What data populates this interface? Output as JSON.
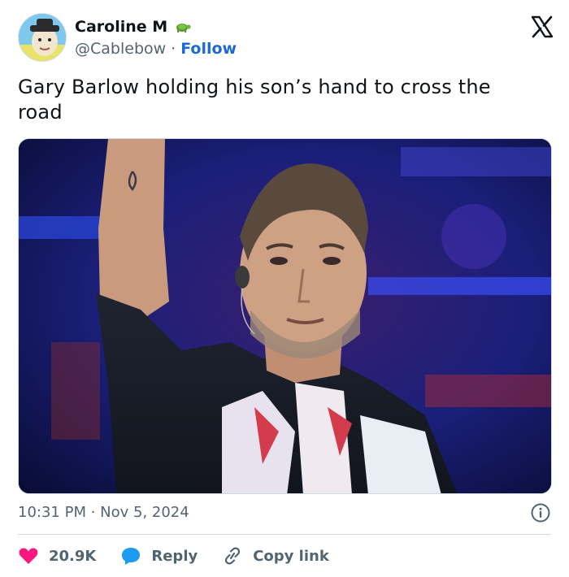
{
  "author": {
    "display_name": "Caroline M",
    "handle": "@Cablebow",
    "separator": "·",
    "follow_label": "Follow",
    "badge_icon": "turtle-emoji-icon"
  },
  "platform": {
    "logo_icon": "x-logo-icon"
  },
  "tweet": {
    "text": "Gary Barlow holding his son’s hand to cross the road"
  },
  "media": {
    "type": "photo"
  },
  "meta": {
    "time": "10:31 PM",
    "separator": "·",
    "date": "Nov 5, 2024",
    "timestamp_text": "10:31 PM · Nov 5, 2024"
  },
  "actions": {
    "like_count": "20.9K",
    "reply_label": "Reply",
    "copy_link_label": "Copy link"
  },
  "colors": {
    "like": "#f91880",
    "reply": "#1d9bf0",
    "link": "#1d6ad6",
    "muted": "#536471",
    "text": "#0f1419"
  }
}
